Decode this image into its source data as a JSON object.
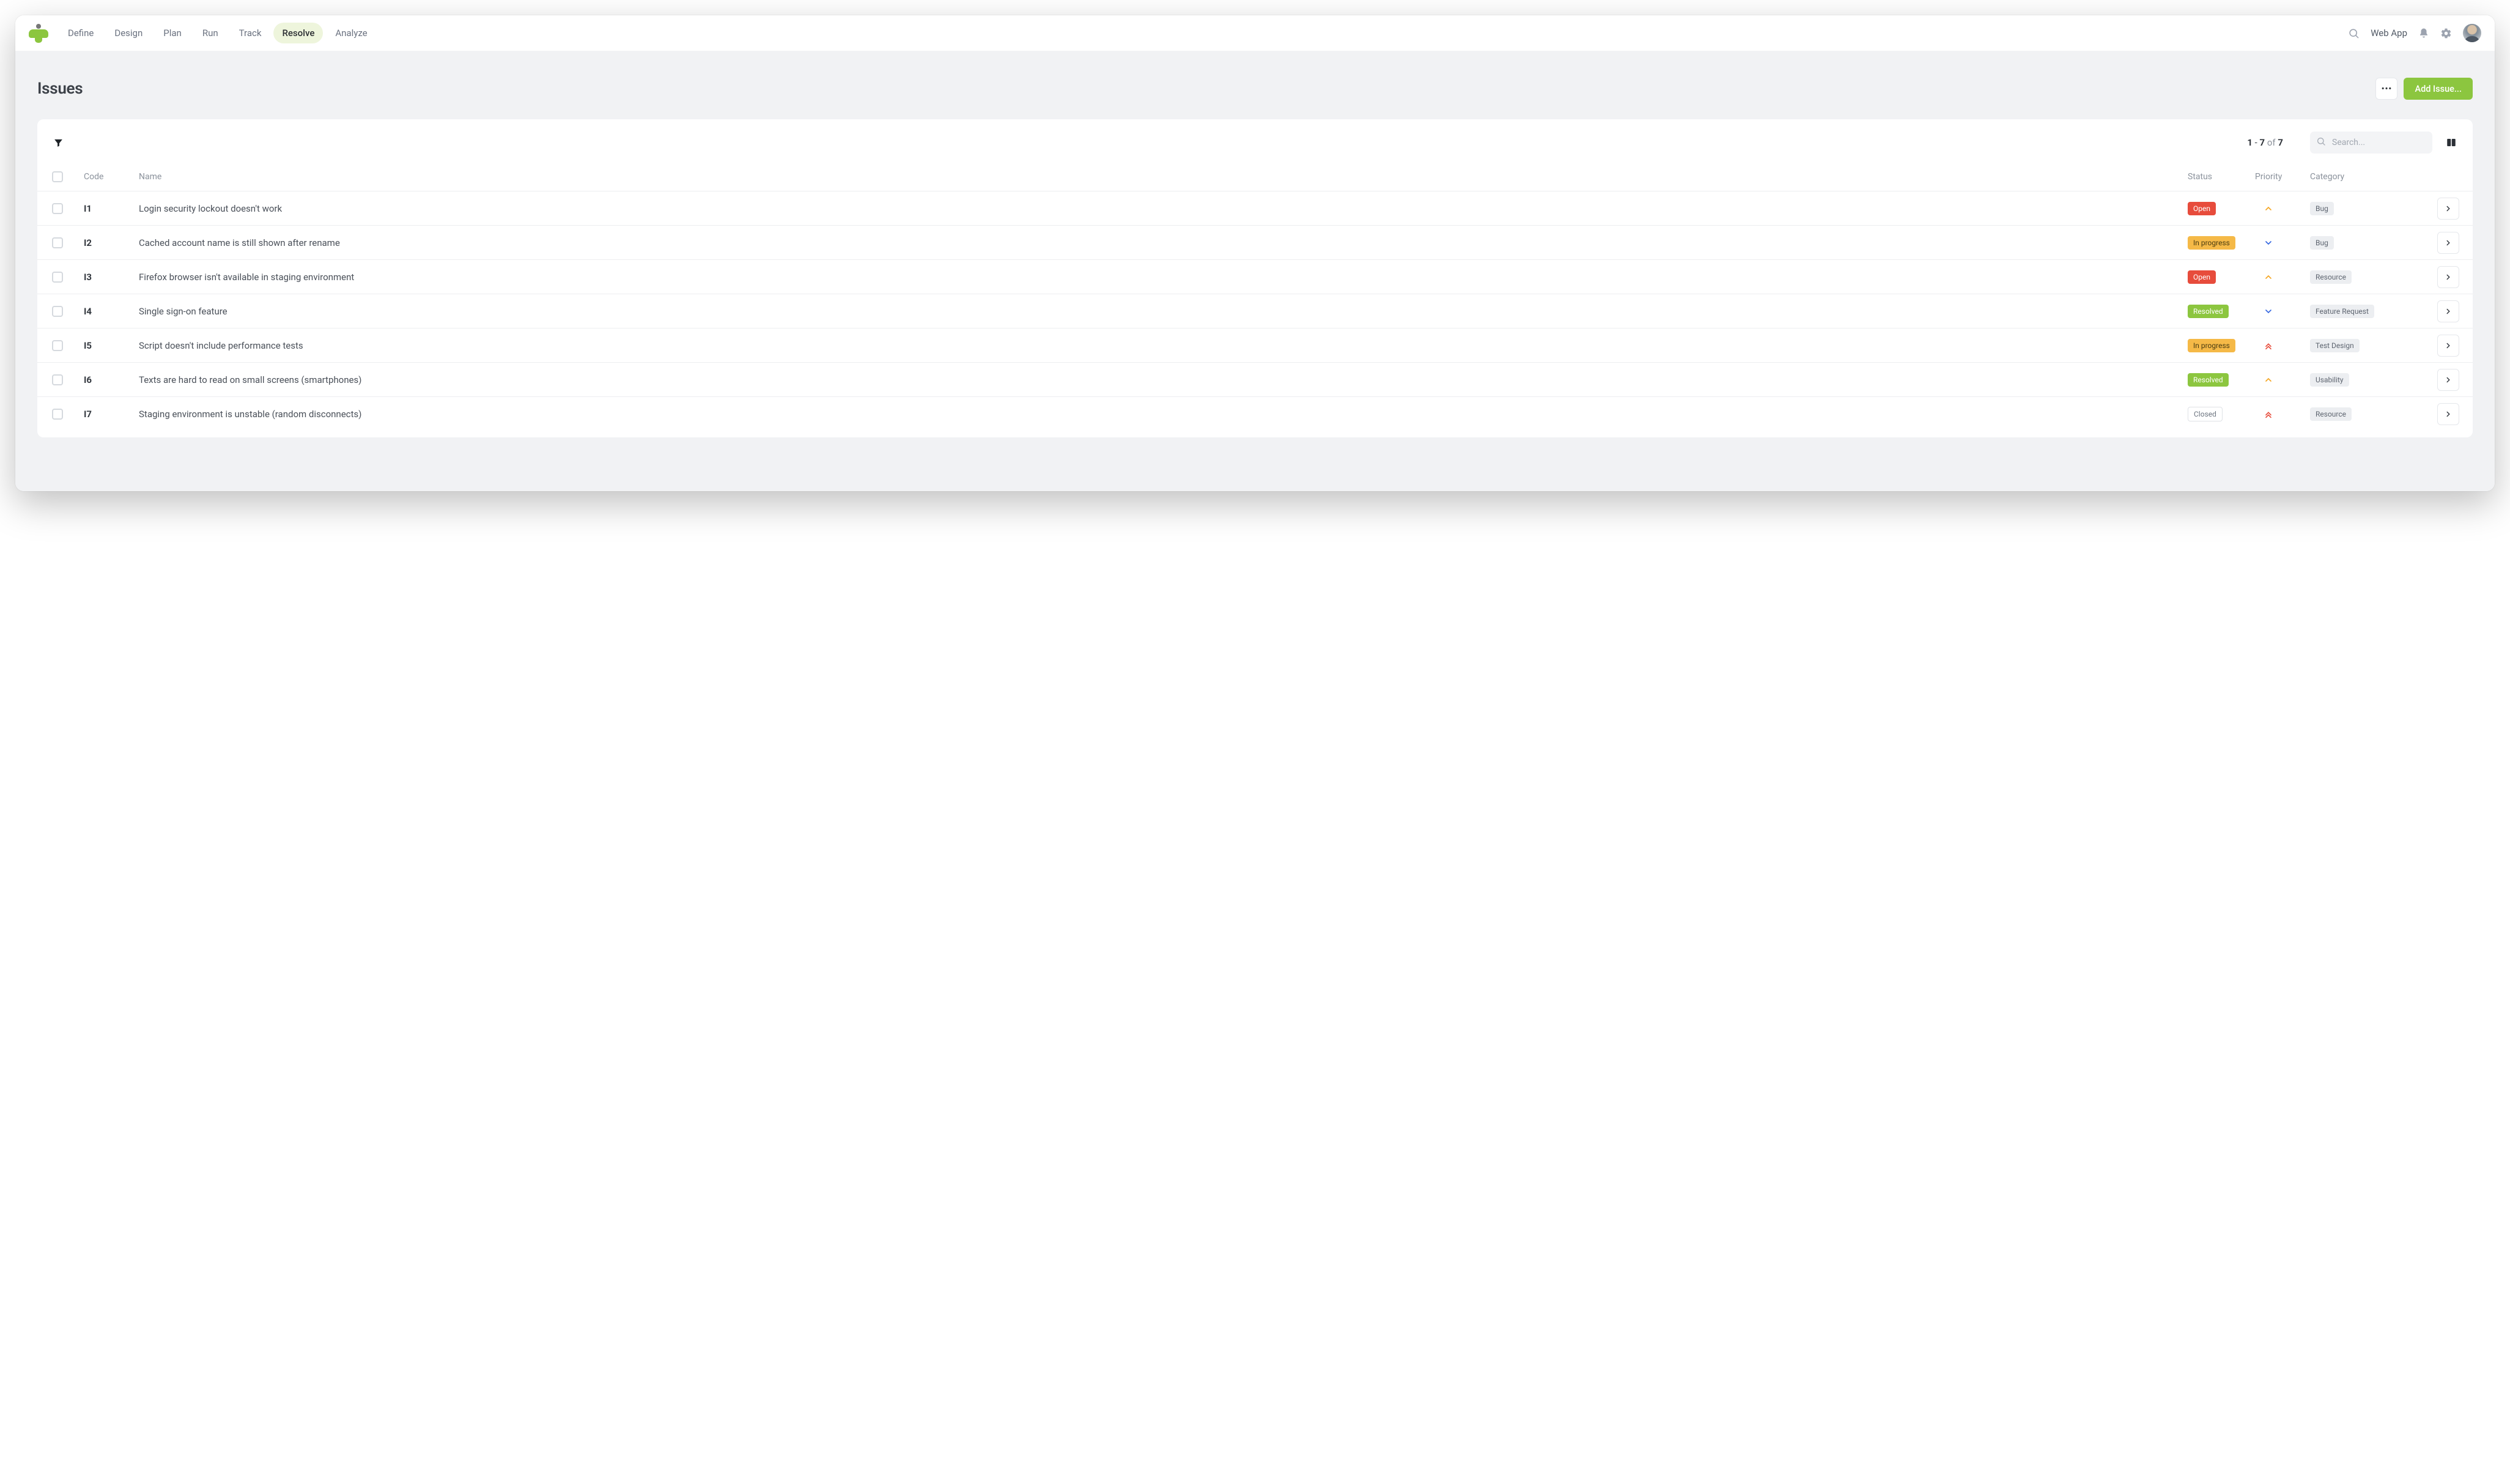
{
  "nav": {
    "items": [
      "Define",
      "Design",
      "Plan",
      "Run",
      "Track",
      "Resolve",
      "Analyze"
    ],
    "activeIndex": 5,
    "rightText": "Web App"
  },
  "page": {
    "title": "Issues",
    "addButton": "Add Issue..."
  },
  "toolbar": {
    "rangeStart": "1",
    "rangeEnd": "7",
    "of": "of",
    "total": "7",
    "searchPlaceholder": "Search..."
  },
  "columns": {
    "code": "Code",
    "name": "Name",
    "status": "Status",
    "priority": "Priority",
    "category": "Category"
  },
  "rows": [
    {
      "code": "I1",
      "name": "Login security lockout doesn't work",
      "status": "Open",
      "statusClass": "open",
      "priority": "medium-up",
      "category": "Bug"
    },
    {
      "code": "I2",
      "name": "Cached account name is still shown after rename",
      "status": "In progress",
      "statusClass": "in-progress",
      "priority": "low-down",
      "category": "Bug"
    },
    {
      "code": "I3",
      "name": "Firefox browser isn't available in staging environment",
      "status": "Open",
      "statusClass": "open",
      "priority": "medium-up",
      "category": "Resource"
    },
    {
      "code": "I4",
      "name": "Single sign-on feature",
      "status": "Resolved",
      "statusClass": "resolved",
      "priority": "low-down",
      "category": "Feature Request"
    },
    {
      "code": "I5",
      "name": "Script doesn't include performance tests",
      "status": "In progress",
      "statusClass": "in-progress",
      "priority": "high",
      "category": "Test Design"
    },
    {
      "code": "I6",
      "name": "Texts are hard to read on small screens (smartphones)",
      "status": "Resolved",
      "statusClass": "resolved",
      "priority": "medium-up",
      "category": "Usability"
    },
    {
      "code": "I7",
      "name": "Staging environment is unstable (random disconnects)",
      "status": "Closed",
      "statusClass": "closed",
      "priority": "high",
      "category": "Resource"
    }
  ]
}
